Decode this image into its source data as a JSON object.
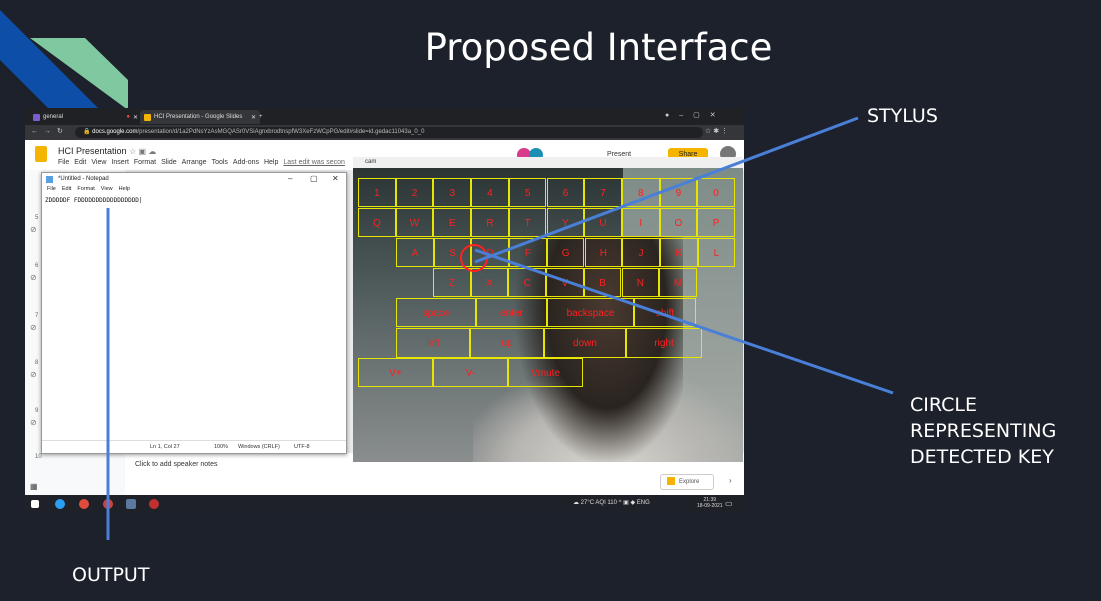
{
  "slide": {
    "title": "Proposed Interface",
    "labels": {
      "stylus": "STYLUS",
      "circle_line1": "CIRCLE",
      "circle_line2": "REPRESENTING",
      "circle_line3": "DETECTED KEY",
      "output": "OUTPUT"
    }
  },
  "browser": {
    "tabs": [
      "general",
      "HCI Presentation - Google Slides"
    ],
    "new_tab": "+",
    "url_host": "docs.google.com",
    "url_path": "/presentation/d/1a2PdNsYzAsMGQASr0VSiAgnxbrodtnspfW3XeFzWCpPG/edit#slide=id.gedac11043a_0_0"
  },
  "slides_app": {
    "doc_title": "HCI Presentation",
    "menu": [
      "File",
      "Edit",
      "View",
      "Insert",
      "Format",
      "Slide",
      "Arrange",
      "Tools",
      "Add-ons",
      "Help"
    ],
    "last_edit": "Last edit was secon",
    "present": "Present",
    "share": "Share",
    "slide_numbers": [
      "5",
      "6",
      "7",
      "8",
      "9",
      "10"
    ],
    "speaker_notes": "Click to add speaker notes",
    "explore": "Explore"
  },
  "notepad": {
    "title": "*Untitled - Notepad",
    "menu": [
      "File",
      "Edit",
      "Format",
      "View",
      "Help"
    ],
    "text": "ZDDDDDF FDDDDDDDDDDDDDDDDD|",
    "status": {
      "position": "Ln 1, Col 27",
      "zoom": "100%",
      "eol": "Windows (CRLF)",
      "encoding": "UTF-8"
    }
  },
  "camera": {
    "title": "cam",
    "rows": [
      [
        "1",
        "2",
        "3",
        "4",
        "5",
        "6",
        "7",
        "8",
        "9",
        "0"
      ],
      [
        "Q",
        "W",
        "E",
        "R",
        "T",
        "Y",
        "U",
        "I",
        "O",
        "P"
      ],
      [
        "A",
        "S",
        "D",
        "F",
        "G",
        "H",
        "J",
        "K",
        "L"
      ],
      [
        "Z",
        "X",
        "C",
        "V",
        "B",
        "N",
        "M"
      ],
      [
        "space",
        "enter",
        "backspace",
        "shift"
      ],
      [
        "left",
        "up",
        "down",
        "right"
      ],
      [
        "V+",
        "V-",
        "Vmute"
      ]
    ]
  },
  "taskbar": {
    "weather": "27°C AQI 110",
    "lang": "ENG",
    "time": "21:39",
    "date": "18-09-2021"
  },
  "colors": {
    "background": "#1c212b",
    "key_border": "#e6e600",
    "key_text": "#ff2020",
    "pointer_line": "#4a7fd8"
  }
}
